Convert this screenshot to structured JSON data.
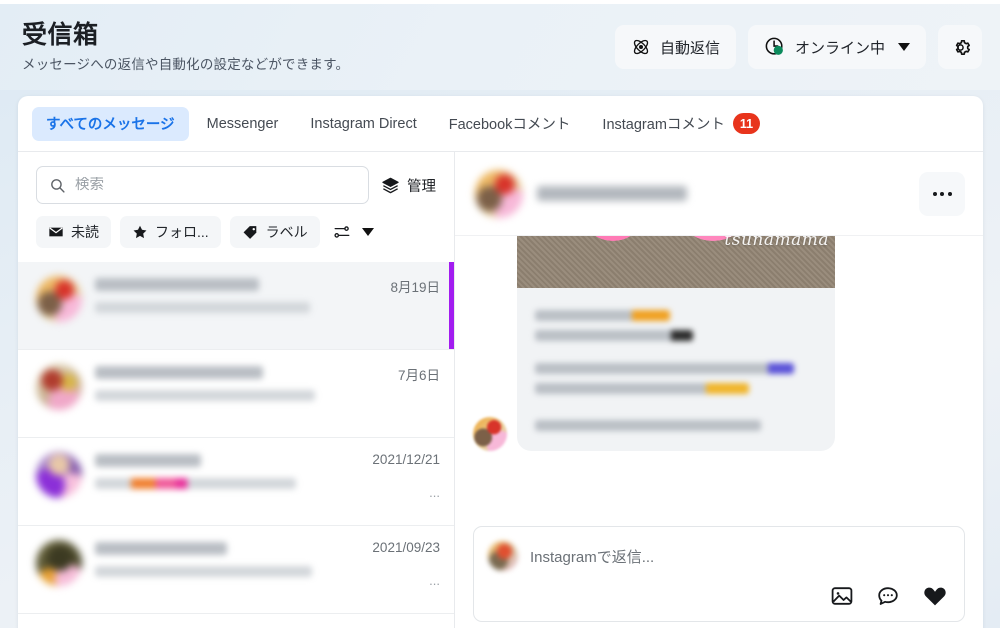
{
  "header": {
    "title": "受信箱",
    "subtitle": "メッセージへの返信や自動化の設定などができます。",
    "auto_reply_label": "自動返信",
    "status_label": "オンライン中",
    "settings_icon": "gear-icon",
    "auto_reply_icon": "atom-icon",
    "status_icon": "clock-online-icon",
    "status_color": "#0b8a5c"
  },
  "tabs": [
    {
      "label": "すべてのメッセージ",
      "active": true,
      "badge": ""
    },
    {
      "label": "Messenger",
      "active": false,
      "badge": ""
    },
    {
      "label": "Instagram Direct",
      "active": false,
      "badge": ""
    },
    {
      "label": "Facebookコメント",
      "active": false,
      "badge": ""
    },
    {
      "label": "Instagramコメント",
      "active": false,
      "badge": "11"
    }
  ],
  "sidebar": {
    "search": {
      "placeholder": "検索",
      "value": "",
      "icon": "search-icon"
    },
    "manage": {
      "label": "管理",
      "icon": "layers-icon"
    },
    "filters": [
      {
        "label": "未読",
        "icon": "envelope-icon"
      },
      {
        "label": "フォロ...",
        "icon": "star-icon"
      },
      {
        "label": "ラベル",
        "icon": "tag-icon"
      }
    ],
    "sort": {
      "icon": "sliders-icon",
      "caret": "chevron-down-icon"
    },
    "conversations": [
      {
        "date": "8月19日",
        "selected": true,
        "truncation": ""
      },
      {
        "date": "7月6日",
        "selected": false,
        "truncation": ""
      },
      {
        "date": "2021/12/21",
        "selected": false,
        "truncation": "..."
      },
      {
        "date": "2021/09/23",
        "selected": false,
        "truncation": "..."
      }
    ]
  },
  "conversation": {
    "more_button": "more-options",
    "message_image_watermark": "tsunamama",
    "composer": {
      "placeholder": "Instagramで返信...",
      "actions": [
        {
          "icon": "image-icon"
        },
        {
          "icon": "quick-reply-icon"
        },
        {
          "icon": "heart-icon"
        }
      ]
    }
  },
  "colors": {
    "accent_selected": "#a21cf0",
    "tab_active_bg": "#dbeafe",
    "tab_active_text": "#1a73e8",
    "badge_bg": "#e8341c",
    "page_bg": "#e9f0f6"
  }
}
